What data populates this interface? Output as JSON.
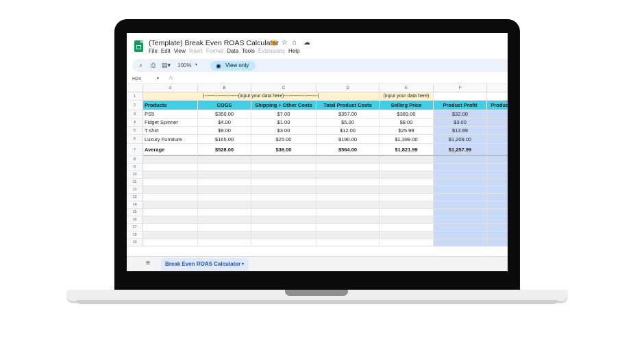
{
  "document": {
    "title": "(Template) Break Even ROAS Calculator"
  },
  "menu": [
    "File",
    "Edit",
    "View",
    "Insert",
    "Format",
    "Data",
    "Tools",
    "Extensions",
    "Help"
  ],
  "menu_disabled": [
    "Insert",
    "Format",
    "Extensions"
  ],
  "toolbar": {
    "zoom": "100%",
    "view_only": "View only",
    "zoom_caret": "▾"
  },
  "formula_bar": {
    "cell_ref": "H24",
    "fx": "fx",
    "caret": "▾"
  },
  "columns": [
    "A",
    "B",
    "C",
    "D",
    "E",
    "F"
  ],
  "rows": [
    "1",
    "2",
    "3",
    "4",
    "5",
    "6",
    "7",
    "8",
    "9",
    "10",
    "11",
    "12",
    "13",
    "14",
    "15",
    "16",
    "17",
    "18",
    "19"
  ],
  "input_note_left": "|---------------------(input your data here)---------------------|",
  "input_note_right": "(input your data here)",
  "headers": [
    "Products",
    "COGS",
    "Shipping + Other Costs",
    "Total Product Costs",
    "Selling Price",
    "Product Profit",
    "Product"
  ],
  "products": [
    {
      "name": "PS5",
      "cogs": "$350.00",
      "shipping": "$7.00",
      "total": "$357.00",
      "price": "$389.00",
      "profit": "$32.00"
    },
    {
      "name": "Fidget Spinner",
      "cogs": "$4.00",
      "shipping": "$1.00",
      "total": "$5.00",
      "price": "$8.00",
      "profit": "$3.00"
    },
    {
      "name": "T shirt",
      "cogs": "$9.00",
      "shipping": "$3.00",
      "total": "$12.00",
      "price": "$25.99",
      "profit": "$13.99"
    },
    {
      "name": "Luxury Furniture",
      "cogs": "$165.00",
      "shipping": "$25.00",
      "total": "$190.00",
      "price": "$1,399.00",
      "profit": "$1,209.00"
    }
  ],
  "average": {
    "label": "Average",
    "cogs": "$528.00",
    "shipping": "$36.00",
    "total": "$564.00",
    "price": "$1,821.99",
    "profit": "$1,257.99"
  },
  "sheet_tab": {
    "name": "Break Even ROAS Calculator",
    "caret": "▾"
  },
  "colors": {
    "header_cyan": "#3fd0e6",
    "input_yellow": "#fff2cc",
    "selection_blue": "#c9daf8",
    "sheets_green": "#0f9d58"
  }
}
